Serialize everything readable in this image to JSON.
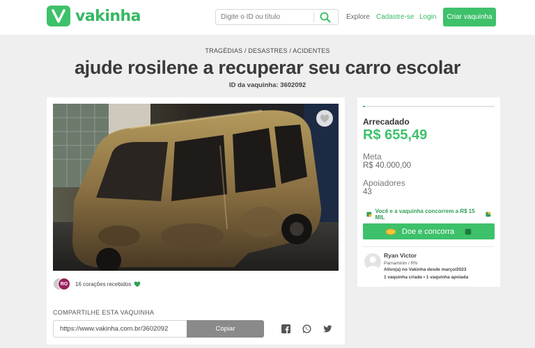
{
  "header": {
    "logo_text": "vakinha",
    "search_placeholder": "Digite o ID ou título",
    "nav": {
      "explore": "Explore",
      "cadastre": "Cadastre-se",
      "login": "Login"
    },
    "cta_label": "Criar vaquinha"
  },
  "campaign": {
    "category": "TRAGÉDIAS / DESASTRES / ACIDENTES",
    "title": "ajude rosilene a recuperar seu carro escolar",
    "id_text": "ID da vaquinha: 3602092",
    "avatar_initials": "RO",
    "hearts_text": "16 corações recebidos"
  },
  "share": {
    "label": "COMPARTILHE ESTA VAQUINHA",
    "url": "https://www.vakinha.com.br/3602092",
    "copy_label": "Copiar"
  },
  "stats": {
    "progress_fraction": 0.016,
    "raised_label": "Arrecadado",
    "raised_value": "R$ 655,49",
    "meta_label": "Meta",
    "meta_value": "R$ 40.000,00",
    "supporters_label": "Apoiadores",
    "supporters_value": "43",
    "promo_text": "Você e a vaquinha concorrem a R$ 15 MIL",
    "donate_label": "Doe e concorra"
  },
  "organizer": {
    "name": "Ryan Victor",
    "location": "Parnamirim / RN",
    "active_since": "Ativo(a) no Vakinha desde março/2023",
    "stats": "1 vaquinha criada  •  1 vaquinha apoiada"
  },
  "colors": {
    "brand_green": "#3ec16b",
    "copy_gray": "#8a8a8a"
  },
  "icons": [
    "search-icon",
    "heart-icon",
    "clover-icon",
    "coin-icon",
    "facebook-icon",
    "whatsapp-icon",
    "twitter-icon",
    "user-icon"
  ]
}
